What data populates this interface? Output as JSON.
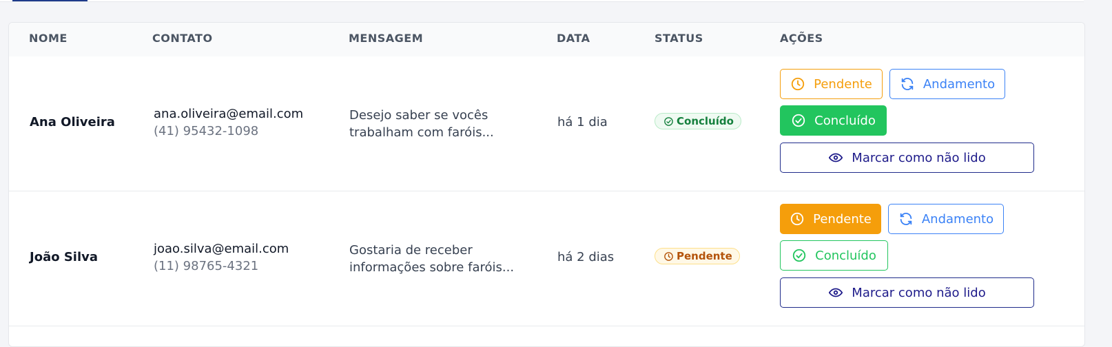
{
  "table": {
    "headers": {
      "nome": "NOME",
      "contato": "CONTATO",
      "mensagem": "MENSAGEM",
      "data": "DATA",
      "status": "STATUS",
      "acoes": "AÇÕES"
    },
    "rows": [
      {
        "name": "Ana Oliveira",
        "email": "ana.oliveira@email.com",
        "phone": "(41) 95432-1098",
        "message": "Desejo saber se vocês trabalham com faróis...",
        "date": "há 1 dia",
        "status": "Concluído",
        "status_color": "#15803d",
        "actions": {
          "pendente": "Pendente",
          "andamento": "Andamento",
          "concluido": "Concluído",
          "mark_unread": "Marcar como não lido"
        }
      },
      {
        "name": "João Silva",
        "email": "joao.silva@email.com",
        "phone": "(11) 98765-4321",
        "message": "Gostaria de receber informações sobre faróis...",
        "date": "há 2 dias",
        "status": "Pendente",
        "status_color": "#b45309",
        "actions": {
          "pendente": "Pendente",
          "andamento": "Andamento",
          "concluido": "Concluído",
          "mark_unread": "Marcar como não lido"
        }
      }
    ]
  },
  "colors": {
    "pendente": "#f59e0b",
    "andamento": "#3b82f6",
    "concluido": "#22c55e",
    "mark_unread": "#1e2a8a"
  },
  "icons": {
    "pendente": "clock-icon",
    "andamento": "refresh-icon",
    "concluido": "check-circle-icon",
    "mark_unread": "eye-icon"
  }
}
